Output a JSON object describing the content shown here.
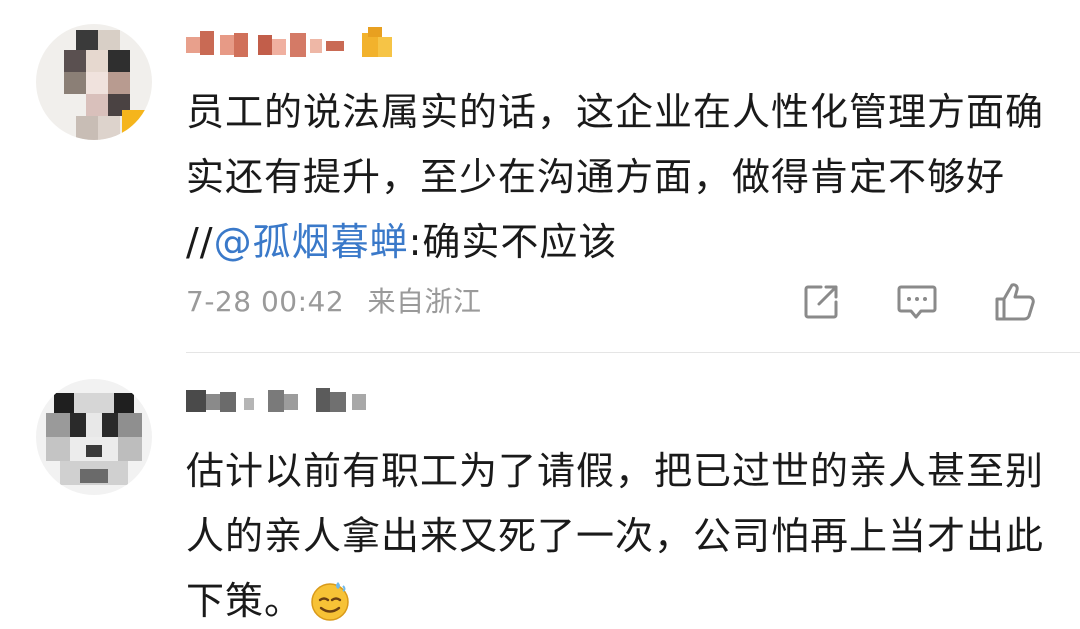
{
  "comments": [
    {
      "text_before": "员工的说法属实的话，这企业在人性化管理方面确实还有提升，至少在沟通方面，做得肯定不够好 //",
      "mention": "@孤烟暮蝉",
      "text_after": ":确实不应该",
      "timestamp": "7-28 00:42",
      "location": "来自浙江",
      "icons": {
        "share": "share-icon",
        "reply": "comment-icon",
        "like": "thumbs-up-icon"
      }
    },
    {
      "text": "估计以前有职工为了请假，把已过世的亲人甚至别人的亲人拿出来又死了一次，公司怕再上当才出此下策。",
      "emoji": "sweat-smile-emoji"
    }
  ]
}
